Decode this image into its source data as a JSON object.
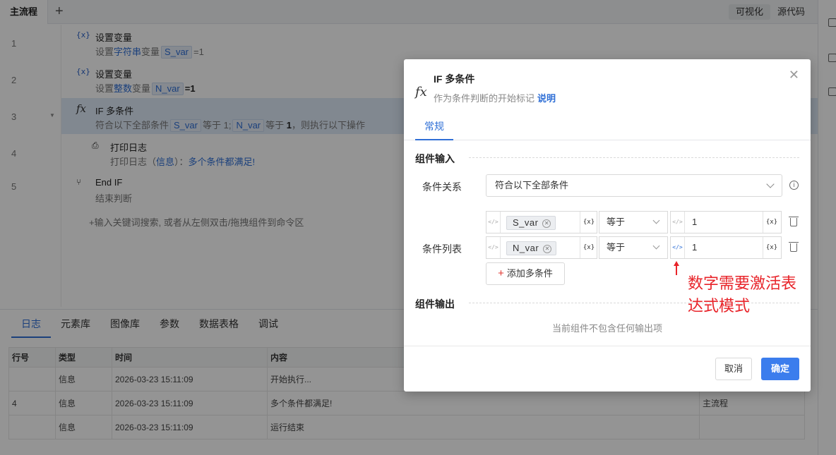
{
  "tabs": {
    "main": "主流程",
    "add": "+"
  },
  "view_toggle": {
    "visual": "可视化",
    "source": "源代码"
  },
  "line_numbers": [
    "1",
    "2",
    "3",
    "4",
    "5"
  ],
  "commands": [
    {
      "icon": "{x}",
      "title": "设置变量",
      "desc_prefix": "设置",
      "desc_type": "字符串",
      "desc_mid": "变量",
      "var": "S_var",
      "desc_suffix": "=1"
    },
    {
      "icon": "{x}",
      "title": "设置变量",
      "desc_prefix": "设置",
      "desc_type": "整数",
      "desc_mid": "变量",
      "var": "N_var",
      "desc_suffix": "=1"
    },
    {
      "icon": "fx",
      "title": "IF 多条件",
      "desc_prefix": "符合以下全部条件",
      "var1": "S_var",
      "op1": "等于 1;",
      "var2": "N_var",
      "op2": "等于",
      "val2": "1",
      "desc_suffix": "，则执行以下操作"
    },
    {
      "title": "打印日志",
      "desc_prefix": "打印日志（",
      "level": "信息",
      "desc_mid": "）：",
      "msg": "多个条件都满足!"
    },
    {
      "title": "End IF",
      "desc": "结束判断"
    }
  ],
  "hint": "+输入关键词搜索, 或者从左侧双击/拖拽组件到命令区",
  "bottom_tabs": [
    "日志",
    "元素库",
    "图像库",
    "参数",
    "数据表格",
    "调试"
  ],
  "log_table": {
    "headers": [
      "行号",
      "类型",
      "时间",
      "内容",
      ""
    ],
    "rows": [
      [
        "",
        "信息",
        "2026-03-23 15:11:09",
        "开始执行...",
        ""
      ],
      [
        "4",
        "信息",
        "2026-03-23 15:11:09",
        "多个条件都满足!",
        "主流程"
      ],
      [
        "",
        "信息",
        "2026-03-23 15:11:09",
        "运行结束",
        ""
      ]
    ]
  },
  "dialog": {
    "icon": "fx",
    "title": "IF 多条件",
    "subtitle": "作为条件判断的开始标记",
    "help_link": "说明",
    "close": "✕",
    "tab": "常规",
    "input_section": "组件输入",
    "relation_label": "条件关系",
    "relation_value": "符合以下全部条件",
    "list_label": "条件列表",
    "conditions": [
      {
        "var": "S_var",
        "op": "等于",
        "value": "1"
      },
      {
        "var": "N_var",
        "op": "等于",
        "value": "1"
      }
    ],
    "expr_btn": "{x}",
    "add_condition": "添加多条件",
    "output_section": "组件输出",
    "no_output": "当前组件不包含任何输出项",
    "cancel": "取消",
    "ok": "确定"
  },
  "annotation": "数字需要激活表达式模式",
  "colors": {
    "accent": "#2f6fd6",
    "primary_button": "#3b7ded",
    "annotation": "#e8242a",
    "row_highlight": "#dfeaf8"
  }
}
